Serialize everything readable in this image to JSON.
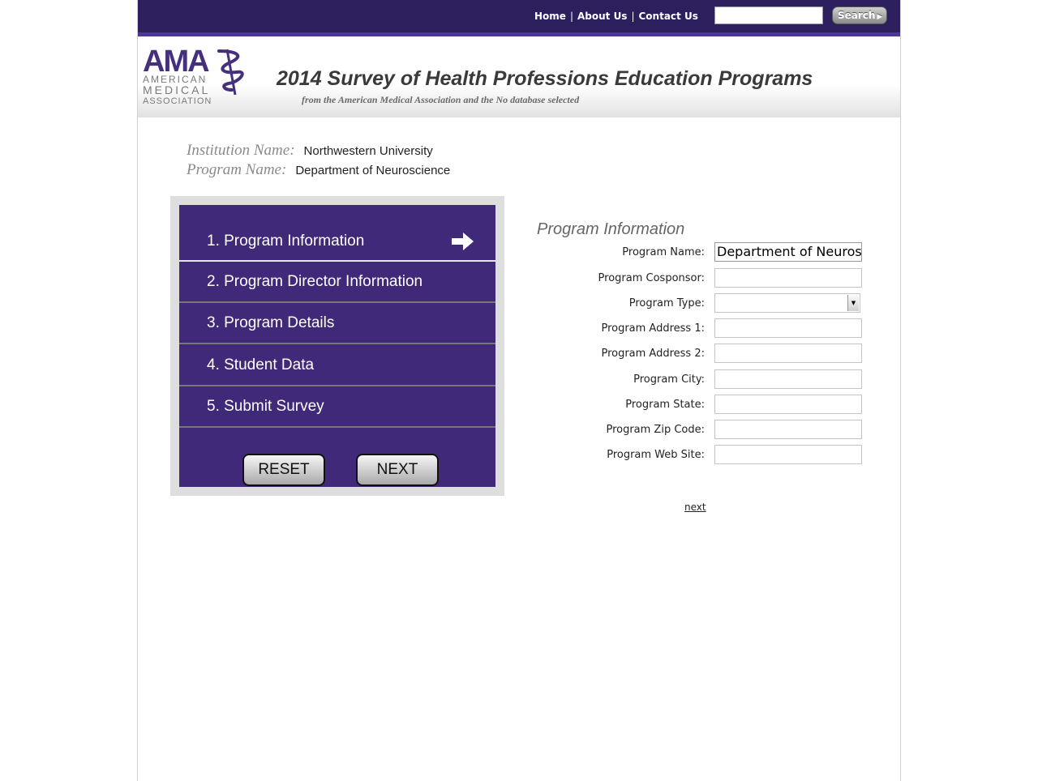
{
  "top_nav": {
    "links": [
      "Home",
      "About Us",
      "Contact Us"
    ],
    "search_button_label": "Search"
  },
  "header": {
    "logo_text": [
      "AMA",
      "AMERICAN",
      "MEDICAL",
      "ASSOCIATION"
    ],
    "title": "2014 Survey of Health Professions Education Programs",
    "subtitle": "from the American Medical Association and the No database selected"
  },
  "institution": {
    "institution_label": "Institution Name:",
    "institution_value": "Northwestern University",
    "program_label": "Program Name:",
    "program_value": "Department of Neuroscience"
  },
  "steps": {
    "items": [
      {
        "label": "1. Program Information",
        "active": true
      },
      {
        "label": "2. Program Director Information",
        "active": false
      },
      {
        "label": "3. Program Details",
        "active": false
      },
      {
        "label": "4. Student Data",
        "active": false
      },
      {
        "label": "5. Submit Survey",
        "active": false
      }
    ],
    "reset_label": "RESET",
    "next_label": "NEXT"
  },
  "form": {
    "title": "Program Information",
    "fields": [
      {
        "label": "Program Name:",
        "value": "Department of Neuroscience"
      },
      {
        "label": "Program Cosponsor:",
        "value": ""
      },
      {
        "label": "Program Type:",
        "value": ""
      },
      {
        "label": "Program Address 1:",
        "value": ""
      },
      {
        "label": "Program Address 2:",
        "value": ""
      },
      {
        "label": "Program City:",
        "value": ""
      },
      {
        "label": "Program State:",
        "value": ""
      },
      {
        "label": "Program Zip Code:",
        "value": ""
      },
      {
        "label": "Program Web Site:",
        "value": ""
      }
    ],
    "next_link": "next"
  },
  "colors": {
    "brand_purple": "#2d1f5e",
    "menu_purple": "#41297a",
    "accent_purple": "#4e3a8c"
  }
}
